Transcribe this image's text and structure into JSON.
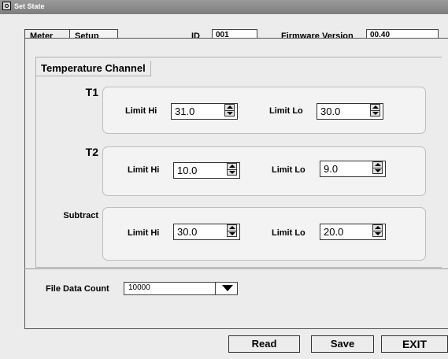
{
  "window": {
    "title": "Set State"
  },
  "tabs": [
    {
      "label": "Meter"
    },
    {
      "label": "Setup"
    }
  ],
  "header": {
    "id_label": "ID",
    "id_value": "001",
    "firmware_label": "Firmware Version",
    "firmware_value": "00.40"
  },
  "group": {
    "title": "Temperature Channel"
  },
  "channels": [
    {
      "name": "T1",
      "limit_hi_label": "Limit Hi",
      "limit_hi": "31.0",
      "limit_lo_label": "Limit Lo",
      "limit_lo": "30.0"
    },
    {
      "name": "T2",
      "limit_hi_label": "Limit Hi",
      "limit_hi": "10.0",
      "limit_lo_label": "Limit Lo",
      "limit_lo": "9.0"
    },
    {
      "name": "Subtract",
      "limit_hi_label": "Limit Hi",
      "limit_hi": "30.0",
      "limit_lo_label": "Limit Lo",
      "limit_lo": "20.0"
    }
  ],
  "file_data_count": {
    "label": "File Data Count",
    "value": "10000"
  },
  "buttons": {
    "read": "Read",
    "save": "Save",
    "exit": "EXIT"
  }
}
